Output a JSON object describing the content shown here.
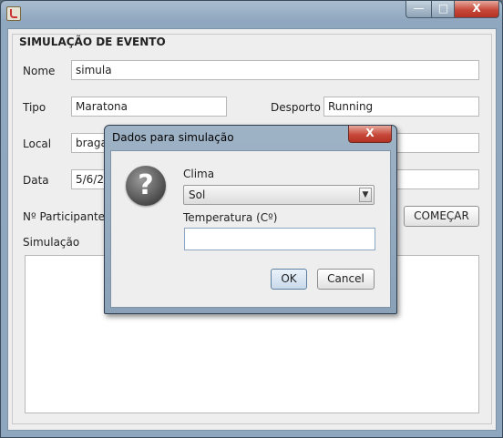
{
  "window": {
    "title": "",
    "icon": "java-cup-icon",
    "controls": {
      "minimize": "—",
      "maximize": "□",
      "close": "X"
    }
  },
  "form": {
    "group_title": "SIMULAÇÃO DE EVENTO",
    "nome_label": "Nome",
    "nome_value": "simula",
    "tipo_label": "Tipo",
    "tipo_value": "Maratona",
    "desporto_label": "Desporto",
    "desporto_value": "Running",
    "local_label": "Local",
    "local_value": "braga",
    "data_label": "Data",
    "data_value": "5/6/20",
    "participantes_label": "Nº Participantes",
    "comecar_button": "COMEÇAR",
    "simulacao_label": "Simulação"
  },
  "dialog": {
    "title": "Dados para simulação",
    "close": "X",
    "icon": "question-icon",
    "icon_glyph": "?",
    "clima_label": "Clima",
    "clima_selected": "Sol",
    "dropdown_arrow": "▼",
    "temperatura_label": "Temperatura (Cº)",
    "temperatura_value": "",
    "ok_button": "OK",
    "cancel_button": "Cancel"
  }
}
